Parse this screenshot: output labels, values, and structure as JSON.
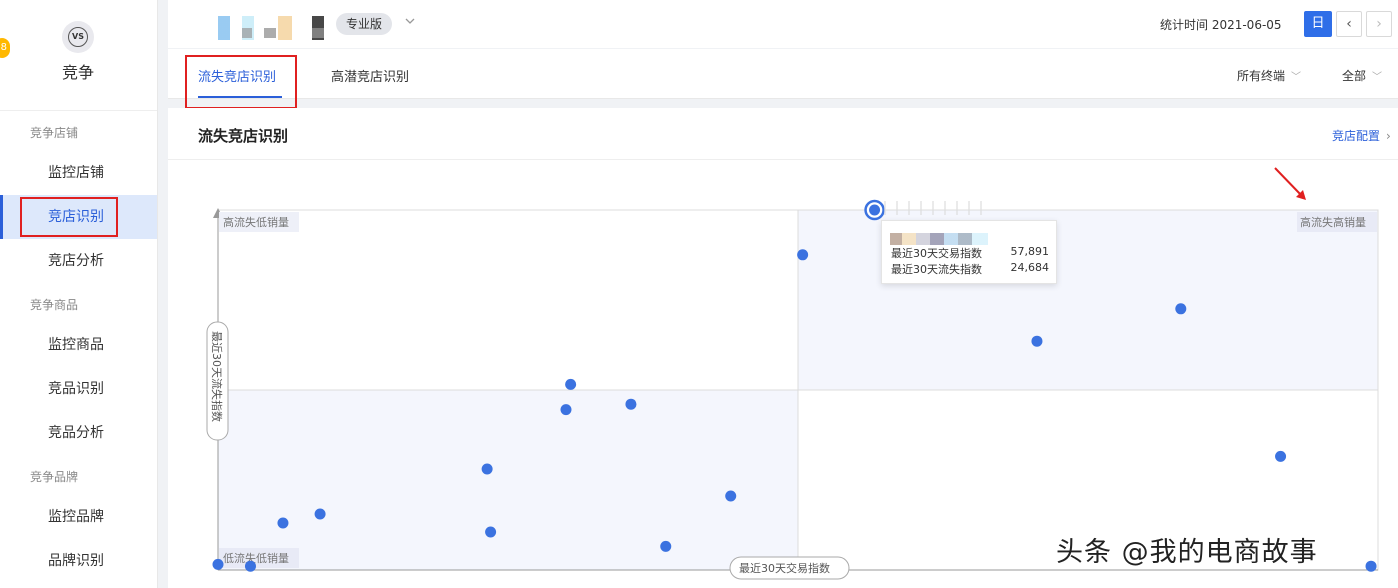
{
  "sidebar": {
    "badge": "8",
    "logo_text": "VS",
    "title": "竞争",
    "groups": [
      {
        "label": "竞争店铺",
        "items": [
          "监控店铺",
          "竞店识别",
          "竞店分析"
        ]
      },
      {
        "label": "竞争商品",
        "items": [
          "监控商品",
          "竞品识别",
          "竞品分析"
        ]
      },
      {
        "label": "竞争品牌",
        "items": [
          "监控品牌",
          "品牌识别"
        ]
      }
    ],
    "active_item": "竞店识别"
  },
  "header": {
    "edition": "专业版",
    "stat_time_label": "统计时间 2021-06-05",
    "day_button": "日",
    "prev": "‹",
    "next": "›"
  },
  "tabs": {
    "items": [
      "流失竞店识别",
      "高潜竞店识别"
    ],
    "active": 0,
    "terminal_filter": "所有终端",
    "scope_filter": "全部"
  },
  "panel": {
    "title": "流失竞店识别",
    "config_link": "竞店配置"
  },
  "chart_data": {
    "type": "scatter",
    "quadrant_labels": {
      "top_left": "高流失低销量",
      "top_right": "高流失高销量",
      "bottom_left": "低流失低销量"
    },
    "xlabel": "最近30天交易指数",
    "ylabel": "最近30天流失指数",
    "x_range": [
      0,
      100
    ],
    "y_range": [
      0,
      100
    ],
    "x_split": 50,
    "y_split": 50,
    "points": [
      {
        "x": 0,
        "y": 1
      },
      {
        "x": 2.8,
        "y": 0.5
      },
      {
        "x": 5.6,
        "y": 12.5
      },
      {
        "x": 8.8,
        "y": 15
      },
      {
        "x": 23.2,
        "y": 27.5
      },
      {
        "x": 23.5,
        "y": 10
      },
      {
        "x": 30.0,
        "y": 44
      },
      {
        "x": 30.4,
        "y": 51
      },
      {
        "x": 35.6,
        "y": 45.5
      },
      {
        "x": 38.6,
        "y": 6
      },
      {
        "x": 44.2,
        "y": 20
      },
      {
        "x": 50.4,
        "y": 87
      },
      {
        "x": 70.6,
        "y": 63
      },
      {
        "x": 83.0,
        "y": 72
      },
      {
        "x": 91.6,
        "y": 31
      },
      {
        "x": 99.4,
        "y": 0.5
      }
    ],
    "highlight": {
      "x": 56.6,
      "y": 100
    },
    "tooltip": {
      "rows": [
        {
          "label": "最近30天交易指数",
          "value": "57,891"
        },
        {
          "label": "最近30天流失指数",
          "value": "24,684"
        }
      ]
    }
  },
  "watermark": "头条 @我的电商故事",
  "colors": {
    "accent": "#2b5fd9",
    "point": "#3b72e0",
    "annotation": "#e02020"
  }
}
